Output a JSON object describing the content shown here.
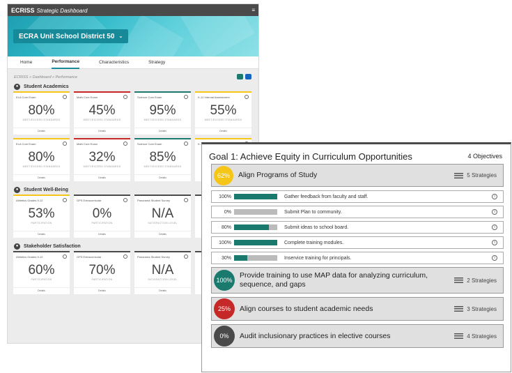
{
  "app": {
    "brand": "ECRISS",
    "subtitle": "Strategic Dashboard",
    "menu_icon": "hamburger-icon"
  },
  "district": {
    "label": "ECRA Unit School District 50",
    "chevron": "chevron-down-icon"
  },
  "tabs": [
    {
      "label": "Home"
    },
    {
      "label": "Performance",
      "active": true
    },
    {
      "label": "Characteristics"
    },
    {
      "label": "Strategy"
    }
  ],
  "breadcrumb": "ECRISS  »  Dashboard  »  Performance",
  "colors": {
    "teal": "#1d8a9a",
    "green": "#1a7a6d",
    "yellow": "#f5c518",
    "red": "#c62828",
    "dark": "#4a4a4a"
  },
  "sections": [
    {
      "title": "Student Academics",
      "rows": [
        [
          {
            "label": "ELA Core Exam",
            "value": "80%",
            "sub": "MEET/EXCEED STANDARDS",
            "color": "#f5c518"
          },
          {
            "label": "Math Core Exam",
            "value": "45%",
            "sub": "MEET/EXCEED STANDARDS",
            "color": "#c62828"
          },
          {
            "label": "Science Core Exam",
            "value": "95%",
            "sub": "MEET/EXCEED STANDARDS",
            "color": "#1a7a6d"
          },
          {
            "label": "K-12 Internal Assessment",
            "value": "55%",
            "sub": "MEET/EXCEED STANDARDS",
            "color": "#f5c518"
          }
        ],
        [
          {
            "label": "ELA Core Exam",
            "value": "80%",
            "sub": "MEET/EXCEED STANDARDS",
            "color": "#f5c518"
          },
          {
            "label": "Math Core Exam",
            "value": "32%",
            "sub": "MEET/EXCEED STANDARDS",
            "color": "#c62828"
          },
          {
            "label": "Science Core Exam",
            "value": "85%",
            "sub": "MEET/EXCEED STANDARDS",
            "color": "#1a7a6d"
          },
          {
            "label": "K-12",
            "value": "",
            "sub": "",
            "color": "#f5c518"
          }
        ]
      ]
    },
    {
      "title": "Student Well-Being",
      "rows": [
        [
          {
            "label": "Athletics Grades 9-12",
            "value": "53%",
            "sub": "PARTICIPATION",
            "color": "#f5c518"
          },
          {
            "label": "GPS Extracurricular",
            "value": "0%",
            "sub": "PARTICIPATION",
            "color": "#4a4a4a"
          },
          {
            "label": "Panorama Student Survey",
            "value": "N/A",
            "sub": "SATISFACTION LEVEL",
            "color": "#4a4a4a"
          },
          {
            "label": "",
            "value": "",
            "sub": "",
            "color": "#4a4a4a"
          }
        ]
      ]
    },
    {
      "title": "Stakeholder Satisfaction",
      "rows": [
        [
          {
            "label": "Athletics Grades 9-12",
            "value": "60%",
            "sub": "PARTICIPATION",
            "color": "#4a4a4a"
          },
          {
            "label": "GPS Extracurricular",
            "value": "70%",
            "sub": "PARTICIPATION",
            "color": "#4a4a4a"
          },
          {
            "label": "Panorama Student Survey",
            "value": "N/A",
            "sub": "SATISFACTION LEVEL",
            "color": "#4a4a4a"
          },
          {
            "label": "",
            "value": "",
            "sub": "",
            "color": "#4a4a4a"
          }
        ]
      ]
    }
  ],
  "details_label": "Details",
  "goal": {
    "title": "Goal 1: Achieve Equity in Curriculum Opportunities",
    "count": "4 Objectives",
    "objectives": [
      {
        "pct": "62%",
        "color": "#f5c518",
        "text": "Align Programs of Study",
        "strategies": "5 Strategies",
        "expanded": true,
        "tasks": [
          {
            "pct": "100%",
            "fill": 1.0,
            "text": "Gather feedback from faculty and staff."
          },
          {
            "pct": "0%",
            "fill": 0.0,
            "text": "Submit Plan to community."
          },
          {
            "pct": "80%",
            "fill": 0.8,
            "text": "Submit ideas to school board."
          },
          {
            "pct": "100%",
            "fill": 1.0,
            "text": "Complete training modules."
          },
          {
            "pct": "30%",
            "fill": 0.3,
            "text": "Inservice training for principals."
          }
        ]
      },
      {
        "pct": "100%",
        "color": "#1a7a6d",
        "text": "Provide training to use MAP data for analyzing curriculum, sequence, and gaps",
        "strategies": "2 Strategies"
      },
      {
        "pct": "25%",
        "color": "#c62828",
        "text": "Align courses to student academic needs",
        "strategies": "3 Strategies"
      },
      {
        "pct": "0%",
        "color": "#4a4a4a",
        "text": "Audit inclusionary practices in elective courses",
        "strategies": "4 Strategies"
      }
    ]
  }
}
